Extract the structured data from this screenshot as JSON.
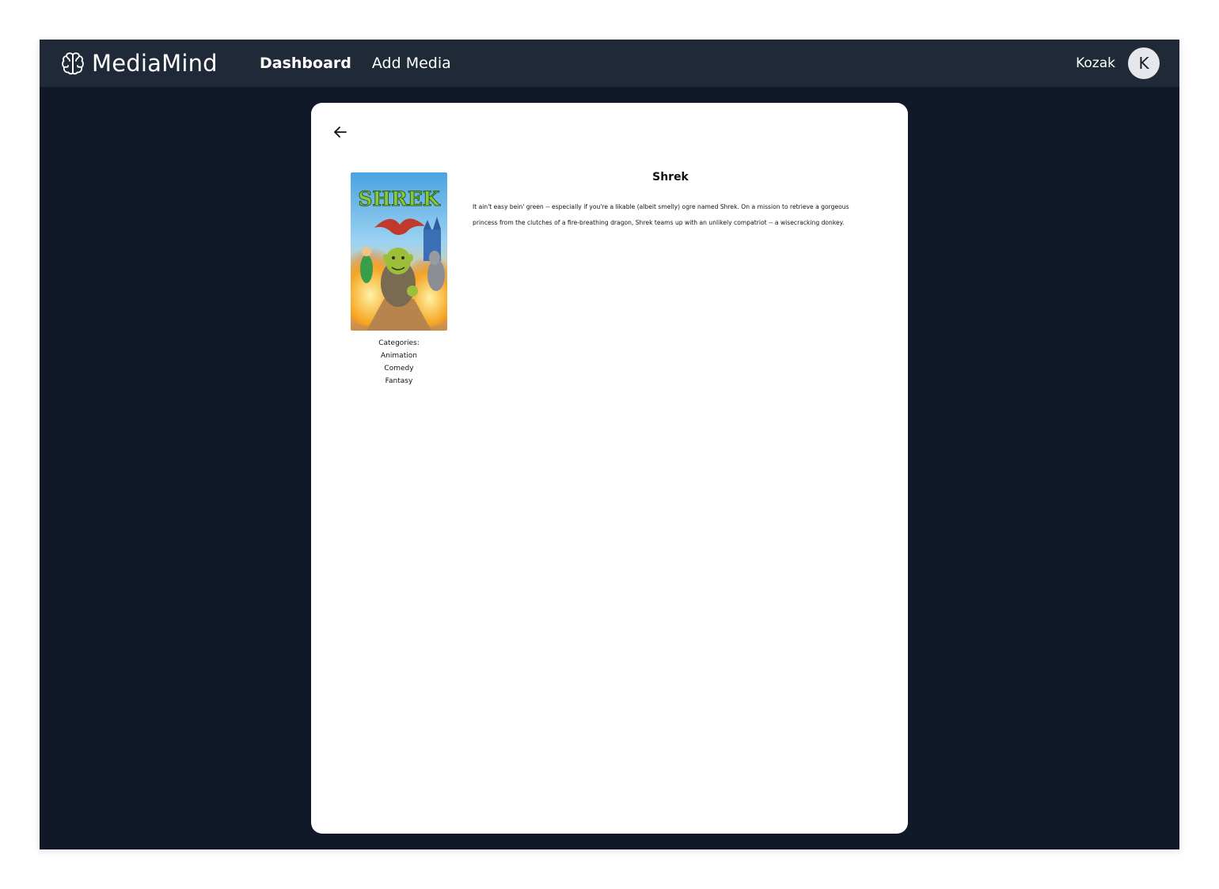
{
  "app": {
    "brand": "MediaMind",
    "nav": {
      "dashboard": "Dashboard",
      "add_media": "Add Media"
    },
    "user": {
      "name": "Kozak",
      "initial": "K"
    }
  },
  "media": {
    "title": "Shrek",
    "description": "It ain't easy bein' green -- especially if you're a likable (albeit smelly) ogre named Shrek. On a mission to retrieve a gorgeous princess from the clutches of a fire-breathing dragon, Shrek teams up with an unlikely compatriot -- a wisecracking donkey.",
    "poster_text": "SHREK",
    "categories_label": "Categories:",
    "categories": [
      "Animation",
      "Comedy",
      "Fantasy"
    ]
  },
  "icons": {
    "brand": "brain-icon",
    "back": "arrow-left-icon"
  },
  "colors": {
    "background": "#111827",
    "navbar": "#1f2937",
    "card": "#ffffff",
    "avatar": "#e5e7eb"
  }
}
